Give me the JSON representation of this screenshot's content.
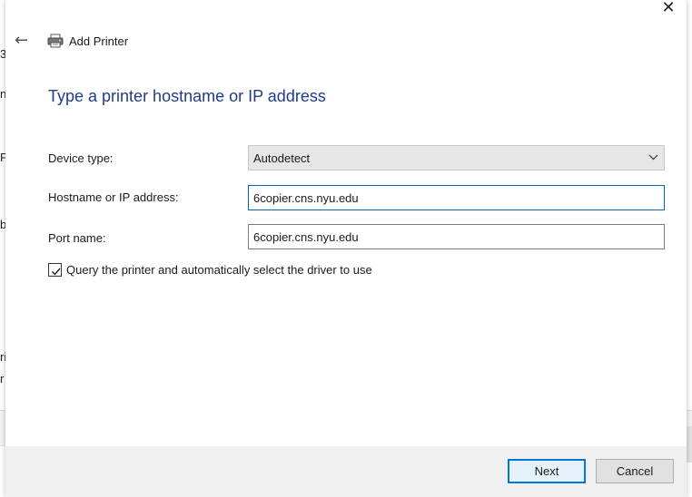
{
  "window": {
    "title": "Add Printer",
    "close_glyph": "✕",
    "back_glyph": "←"
  },
  "background_fragments": [
    "3",
    "n",
    "F",
    "b",
    "ri",
    "r"
  ],
  "page": {
    "heading": "Type a printer hostname or IP address"
  },
  "form": {
    "device_type": {
      "label": "Device type:",
      "value": "Autodetect",
      "chevron": "⌵"
    },
    "hostname": {
      "label": "Hostname or IP address:",
      "value": "6copier.cns.nyu.edu"
    },
    "port": {
      "label": "Port name:",
      "value": "6copier.cns.nyu.edu"
    },
    "query_driver": {
      "label": "Query the printer and automatically select the driver to use",
      "checked": true
    }
  },
  "footer": {
    "next_label": "Next",
    "cancel_label": "Cancel"
  },
  "colors": {
    "heading": "#1f3c88",
    "focus_border": "#0067c0",
    "primary_button_border": "#0078d7"
  },
  "icons": {
    "printer": "printer-icon",
    "back": "back-arrow-icon",
    "close": "close-icon",
    "chevron": "chevron-down-icon",
    "check": "checkmark-icon"
  }
}
